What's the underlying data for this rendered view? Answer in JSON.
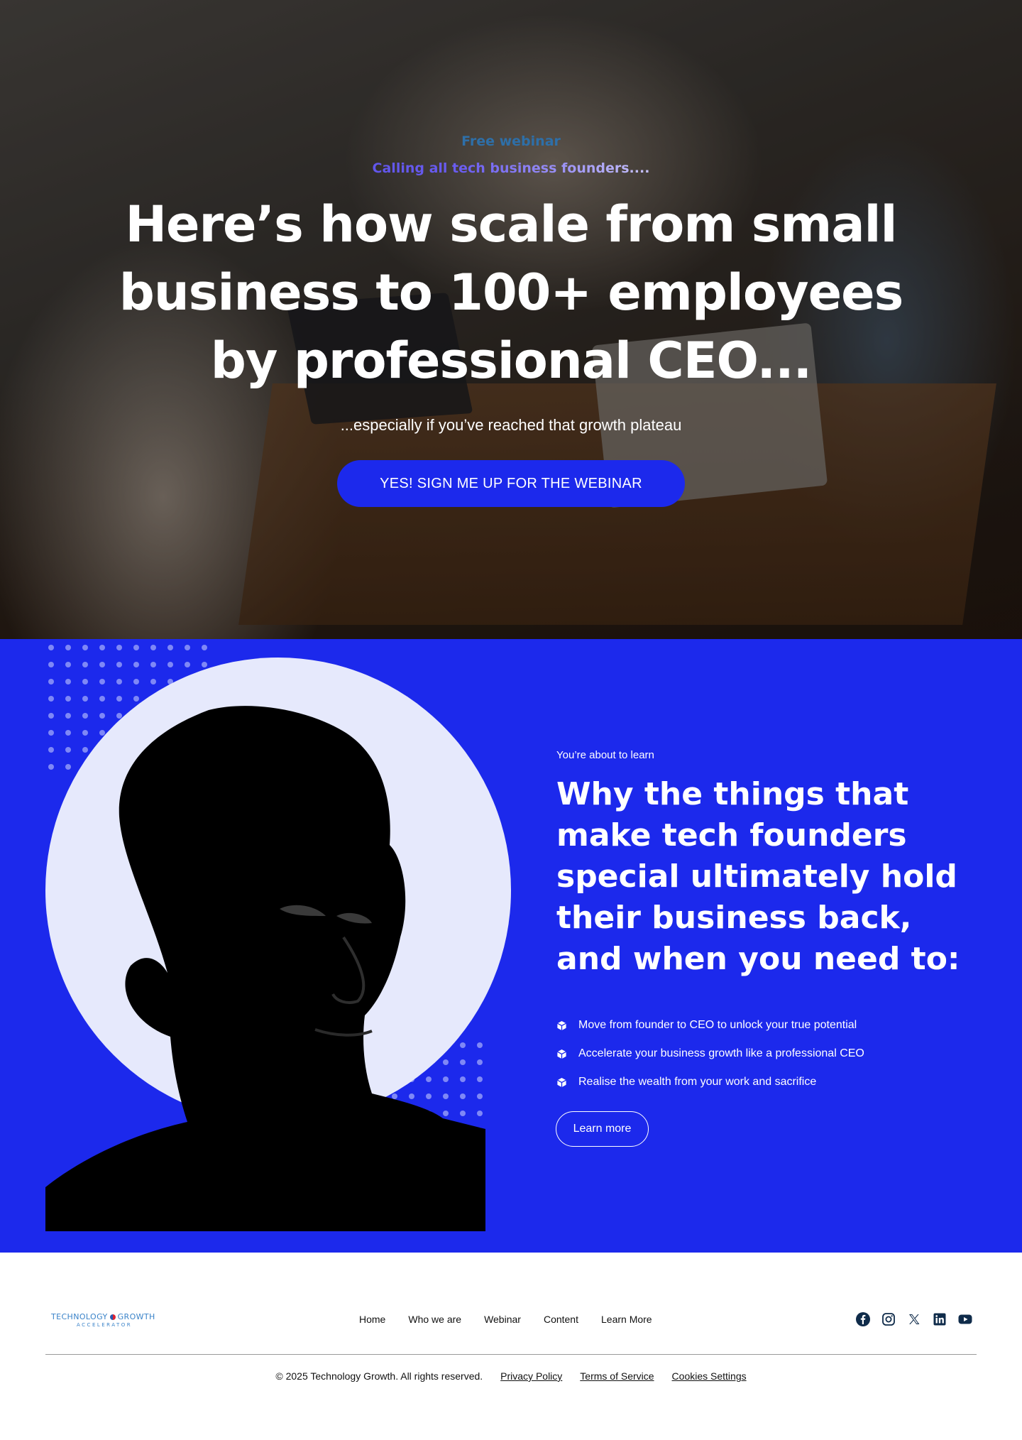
{
  "hero": {
    "eyebrow": "Free webinar",
    "subeyebrow": "Calling all tech business founders....",
    "title": "Here’s how scale from small business to 100+ employees by professional CEO...",
    "subtitle": "...especially if you’ve reached that growth plateau",
    "cta_label": "YES! SIGN ME UP FOR THE WEBINAR",
    "cta_color": "#1c29ec"
  },
  "learn": {
    "eyebrow": "You’re about to learn",
    "title": "Why the things that make tech founders special ultimately hold their business back, and when you need to:",
    "bullets": [
      "Move from founder to CEO to unlock your true potential",
      "Accelerate your business growth like a professional CEO",
      "Realise the wealth from your work  and sacrifice"
    ],
    "button_label": "Learn more",
    "background_color": "#1c29ec"
  },
  "footer": {
    "logo": {
      "line1a": "TECHNOLOGY",
      "line1b": "GROWTH",
      "line2": "ACCELERATOR"
    },
    "nav": [
      "Home",
      "Who we are",
      "Webinar",
      "Content",
      "Learn More"
    ],
    "socials": [
      "facebook-icon",
      "instagram-icon",
      "x-icon",
      "linkedin-icon",
      "youtube-icon"
    ],
    "copyright": "© 2025 Technology Growth. All rights reserved.",
    "links": [
      "Privacy Policy",
      "Terms of Service",
      "Cookies Settings"
    ]
  }
}
